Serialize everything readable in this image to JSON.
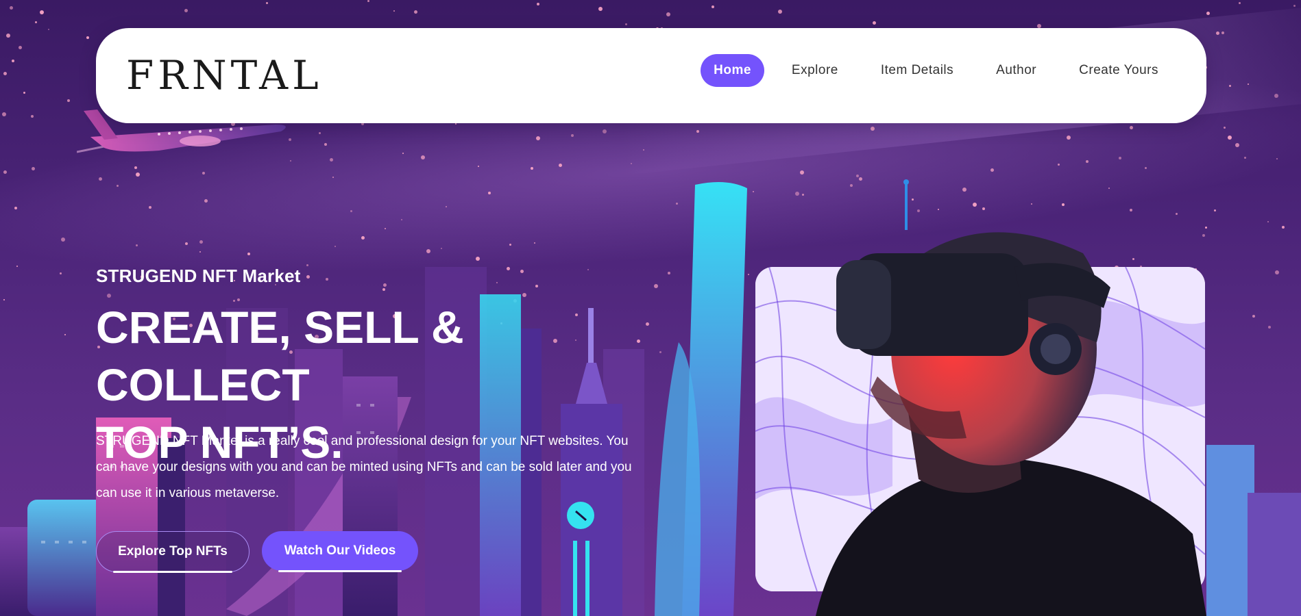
{
  "nav": {
    "logo": "FRNTAL",
    "items": [
      {
        "label": "Home",
        "active": true
      },
      {
        "label": "Explore",
        "active": false
      },
      {
        "label": "Item Details",
        "active": false
      },
      {
        "label": "Author",
        "active": false
      },
      {
        "label": "Create Yours",
        "active": false
      }
    ]
  },
  "hero": {
    "eyebrow": "STRUGEND NFT Market",
    "headline_line1": "CREATE, SELL & COLLECT",
    "headline_line2": "TOP NFT’S.",
    "description": "STRUGEND NFT Market is a really cool and professional design for your NFT websites. You can have your designs with you and can be minted using NFTs and can be sold later and you can use it in various metaverse.",
    "buttons": {
      "explore": "Explore Top NFTs",
      "watch": "Watch Our Videos"
    }
  },
  "colors": {
    "accent": "#7453fc",
    "background": "#4b2478",
    "star": "#f6a3c4"
  },
  "icons": {
    "plane": "airplane-illustration",
    "city": "neon-city-illustration",
    "person": "vr-headset-person-illustration"
  }
}
